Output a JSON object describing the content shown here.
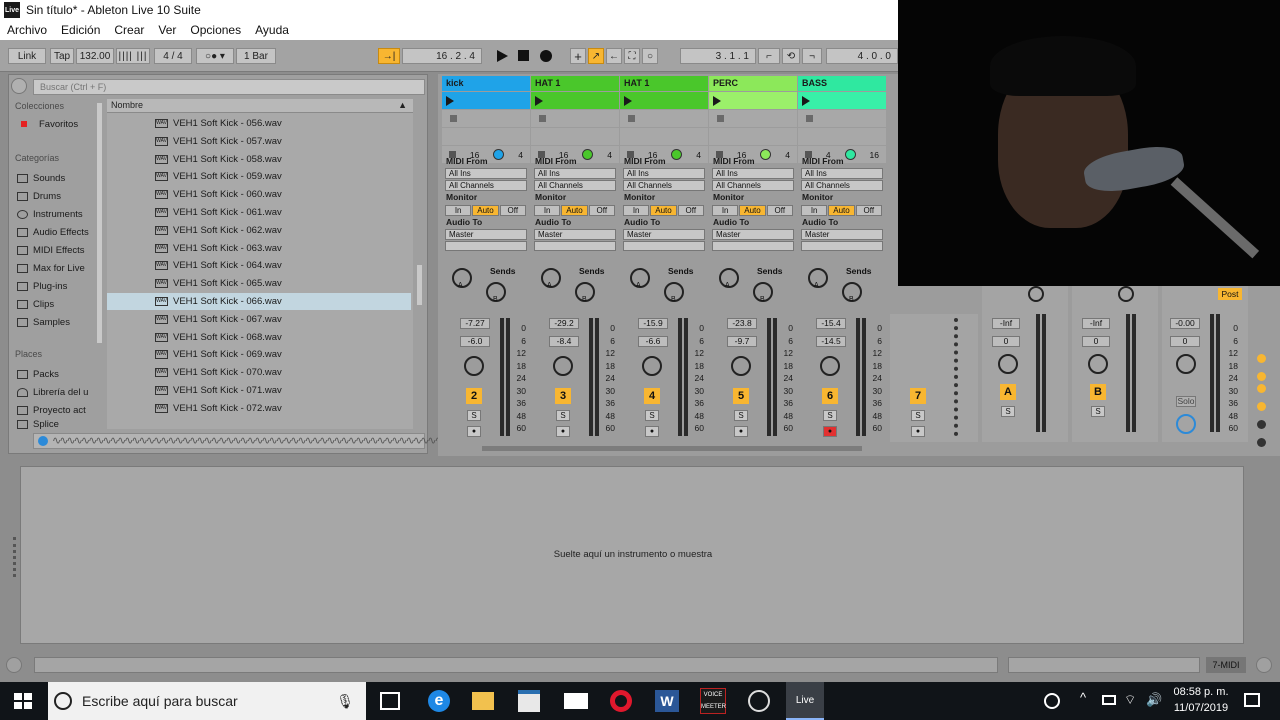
{
  "app": {
    "title": "Sin título* - Ableton Live 10 Suite",
    "logo": "Live"
  },
  "menu": [
    "Archivo",
    "Edición",
    "Crear",
    "Ver",
    "Opciones",
    "Ayuda"
  ],
  "transport": {
    "link": "Link",
    "tap": "Tap",
    "tempo": "132.00",
    "signature": "4 / 4",
    "quantize": "1 Bar",
    "position": "16 .  2 .  4",
    "loop_start": "3 .  1 .  1",
    "loop_length": "4 .  0 .  0"
  },
  "browser": {
    "search_placeholder": "Buscar (Ctrl + F)",
    "collections_label": "Colecciones",
    "favorites": "Favoritos",
    "categories_label": "Categorías",
    "categories": [
      "Sounds",
      "Drums",
      "Instruments",
      "Audio Effects",
      "MIDI Effects",
      "Max for Live",
      "Plug-ins",
      "Clips",
      "Samples"
    ],
    "places_label": "Places",
    "places": [
      "Packs",
      "Librería del u",
      "Proyecto act",
      "Splice"
    ],
    "column_name": "Nombre",
    "files": [
      "VEH1 Soft Kick - 056.wav",
      "VEH1 Soft Kick - 057.wav",
      "VEH1 Soft Kick - 058.wav",
      "VEH1 Soft Kick - 059.wav",
      "VEH1 Soft Kick - 060.wav",
      "VEH1 Soft Kick - 061.wav",
      "VEH1 Soft Kick - 062.wav",
      "VEH1 Soft Kick - 063.wav",
      "VEH1 Soft Kick - 064.wav",
      "VEH1 Soft Kick - 065.wav",
      "VEH1 Soft Kick - 066.wav",
      "VEH1 Soft Kick - 067.wav",
      "VEH1 Soft Kick - 068.wav",
      "VEH1 Soft Kick - 069.wav",
      "VEH1 Soft Kick - 070.wav",
      "VEH1 Soft Kick - 071.wav",
      "VEH1 Soft Kick - 072.wav"
    ],
    "selected_file": "VEH1 Soft Kick - 066.wav",
    "file_icon": "WAV"
  },
  "tracks": [
    {
      "name": "kick",
      "color": "#1fa3e8",
      "clip_color": "#1fa3e8",
      "num": "2",
      "vol": "-7.27",
      "pan": "-6.0",
      "steps_a": "16",
      "steps_b": "4"
    },
    {
      "name": "HAT 1",
      "color": "#4ac72b",
      "clip_color": "#4ac72b",
      "num": "3",
      "vol": "-29.2",
      "pan": "-8.4",
      "steps_a": "16",
      "steps_b": "4"
    },
    {
      "name": "HAT 1",
      "color": "#4ac72b",
      "clip_color": "#4ac72b",
      "num": "4",
      "vol": "-15.9",
      "pan": "-6.6",
      "steps_a": "16",
      "steps_b": "4"
    },
    {
      "name": "PERC",
      "color": "#8ce85a",
      "clip_color": "#9bf06a",
      "num": "5",
      "vol": "-23.8",
      "pan": "-9.7",
      "steps_a": "16",
      "steps_b": "4"
    },
    {
      "name": "BASS",
      "color": "#2fe8a0",
      "clip_color": "#38f0a8",
      "num": "6",
      "vol": "-15.4",
      "pan": "-14.5",
      "steps_a": "4",
      "steps_b": "16"
    }
  ],
  "io": {
    "midi_from": "MIDI From",
    "all_ins": "All Ins",
    "all_channels": "All Channels",
    "monitor": "Monitor",
    "mon_in": "In",
    "mon_auto": "Auto",
    "mon_off": "Off",
    "audio_to": "Audio To",
    "master": "Master",
    "sends": "Sends",
    "solo_s": "S",
    "send_a": "A",
    "send_b": "B"
  },
  "meter_scale": [
    "0",
    "6",
    "12",
    "18",
    "24",
    "30",
    "36",
    "48",
    "60"
  ],
  "extra_track": {
    "num": "7"
  },
  "returns": [
    {
      "num": "A",
      "vol": "-Inf",
      "pan": "0"
    },
    {
      "num": "B",
      "vol": "-Inf",
      "pan": "0"
    }
  ],
  "master": {
    "vol": "-0.00",
    "pan": "0",
    "post": "Post",
    "solo": "Solo"
  },
  "device_drop": "Suelte aquí un instrumento o muestra",
  "status_track": "7-MIDI",
  "taskbar": {
    "search": "Escribe aquí para buscar",
    "time": "08:58 p. m.",
    "date": "11/07/2019",
    "voicemeeter": "VOICE MEETER",
    "live": "Live"
  }
}
